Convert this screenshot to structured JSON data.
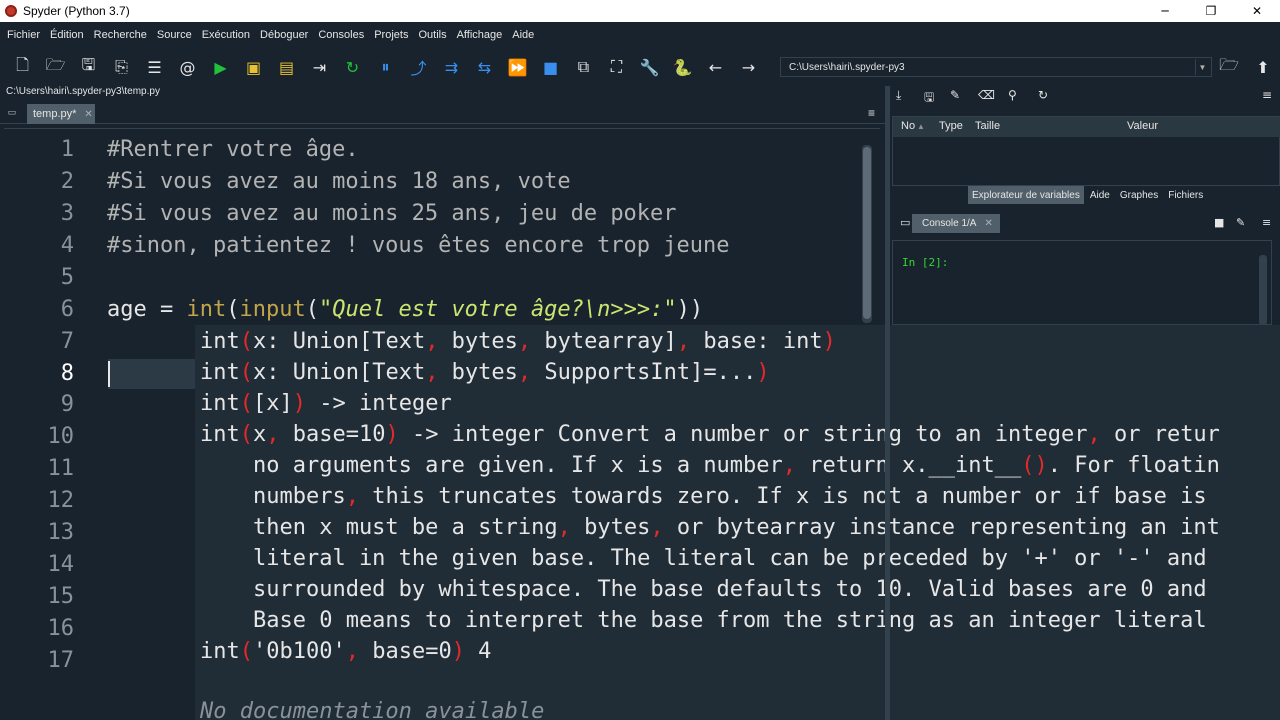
{
  "window": {
    "title": "Spyder (Python 3.7)",
    "minimize": "─",
    "maximize": "❐",
    "close": "✕"
  },
  "menu": [
    "Fichier",
    "Édition",
    "Recherche",
    "Source",
    "Exécution",
    "Déboguer",
    "Consoles",
    "Projets",
    "Outils",
    "Affichage",
    "Aide"
  ],
  "toolbar": {
    "path": "C:\\Users\\hairi\\.spyder-py3"
  },
  "editor": {
    "file_path": "C:\\Users\\hairi\\.spyder-py3\\temp.py",
    "tab_label": "temp.py*",
    "tab_close": "✕",
    "current_line": 8,
    "line_numbers": [
      "1",
      "2",
      "3",
      "4",
      "5",
      "6",
      "7",
      "8",
      "9",
      "10",
      "11",
      "12",
      "13",
      "14",
      "15",
      "16",
      "17"
    ],
    "code": {
      "l1": "#Rentrer votre âge.",
      "l2": "#Si vous avez au moins 18 ans, vote",
      "l3": "#Si vous avez au moins 25 ans, jeu de poker",
      "l4": "#sinon, patientez ! vous êtes encore trop jeune",
      "l6_var": "age = ",
      "l6_int": "int",
      "l6_open": "(",
      "l6_input": "input",
      "l6_open2": "(",
      "l6_str": "\"Quel est votre âge?\\n>>>:\"",
      "l6_close": "))"
    }
  },
  "tooltip": {
    "sig1_a": "int",
    "sig1_b": "(",
    "sig1_c": "x: Union[Text",
    "sig1_d": ",",
    "sig1_e": " bytes",
    "sig1_f": ",",
    "sig1_g": " bytearray]",
    "sig1_h": ",",
    "sig1_i": " base: int",
    "sig1_j": ")",
    "sig2_a": "int",
    "sig2_b": "(",
    "sig2_c": "x: Union[Text",
    "sig2_d": ",",
    "sig2_e": " bytes",
    "sig2_f": ",",
    "sig2_g": " SupportsInt]=...",
    "sig2_h": ")",
    "sig3_a": "int",
    "sig3_b": "(",
    "sig3_c": "[x]",
    "sig3_d": ")",
    "sig3_e": " -> integer",
    "doc1_a": "int",
    "doc1_b": "(",
    "doc1_c": "x",
    "doc1_d": ",",
    "doc1_e": " base=10",
    "doc1_f": ")",
    "doc1_g": " -> integer Convert a number or string to an integer",
    "doc1_h": ",",
    "doc1_i": " or retur",
    "doc2_a": "    no arguments are given. If x is a number",
    "doc2_b": ",",
    "doc2_c": " return x.__int__",
    "doc2_d": "()",
    "doc2_e": ". For floatin",
    "doc3_a": "    numbers",
    "doc3_b": ",",
    "doc3_c": " this truncates towards zero. If x is not a number or if base is",
    "doc4_a": "    then x must be a string",
    "doc4_b": ",",
    "doc4_c": " bytes",
    "doc4_d": ",",
    "doc4_e": " or bytearray instance representing an int",
    "doc5": "    literal in the given base. The literal can be preceded by '+' or '-' and",
    "doc6": "    surrounded by whitespace. The base defaults to 10. Valid bases are 0 and",
    "doc7": "    Base 0 means to interpret the base from the string as an integer literal",
    "ex_a": "int",
    "ex_b": "(",
    "ex_c": "'0b100'",
    "ex_d": ",",
    "ex_e": " base=0",
    "ex_f": ")",
    "ex_g": " 4",
    "nodoc": "No documentation available"
  },
  "variable_explorer": {
    "col_no": "No",
    "col_type": "Type",
    "col_size": "Taille",
    "col_value": "Valeur"
  },
  "right_tabs": [
    "Explorateur de variables",
    "Aide",
    "Graphes",
    "Fichiers"
  ],
  "console": {
    "tab_label": "Console 1/A",
    "tab_close": "✕",
    "prompt": "In [2]:"
  },
  "colors": {
    "background": "#19232d",
    "tooltip": "#202c36",
    "red": "#e22a2a",
    "string": "#cce570",
    "keyword": "#c0a54a"
  }
}
